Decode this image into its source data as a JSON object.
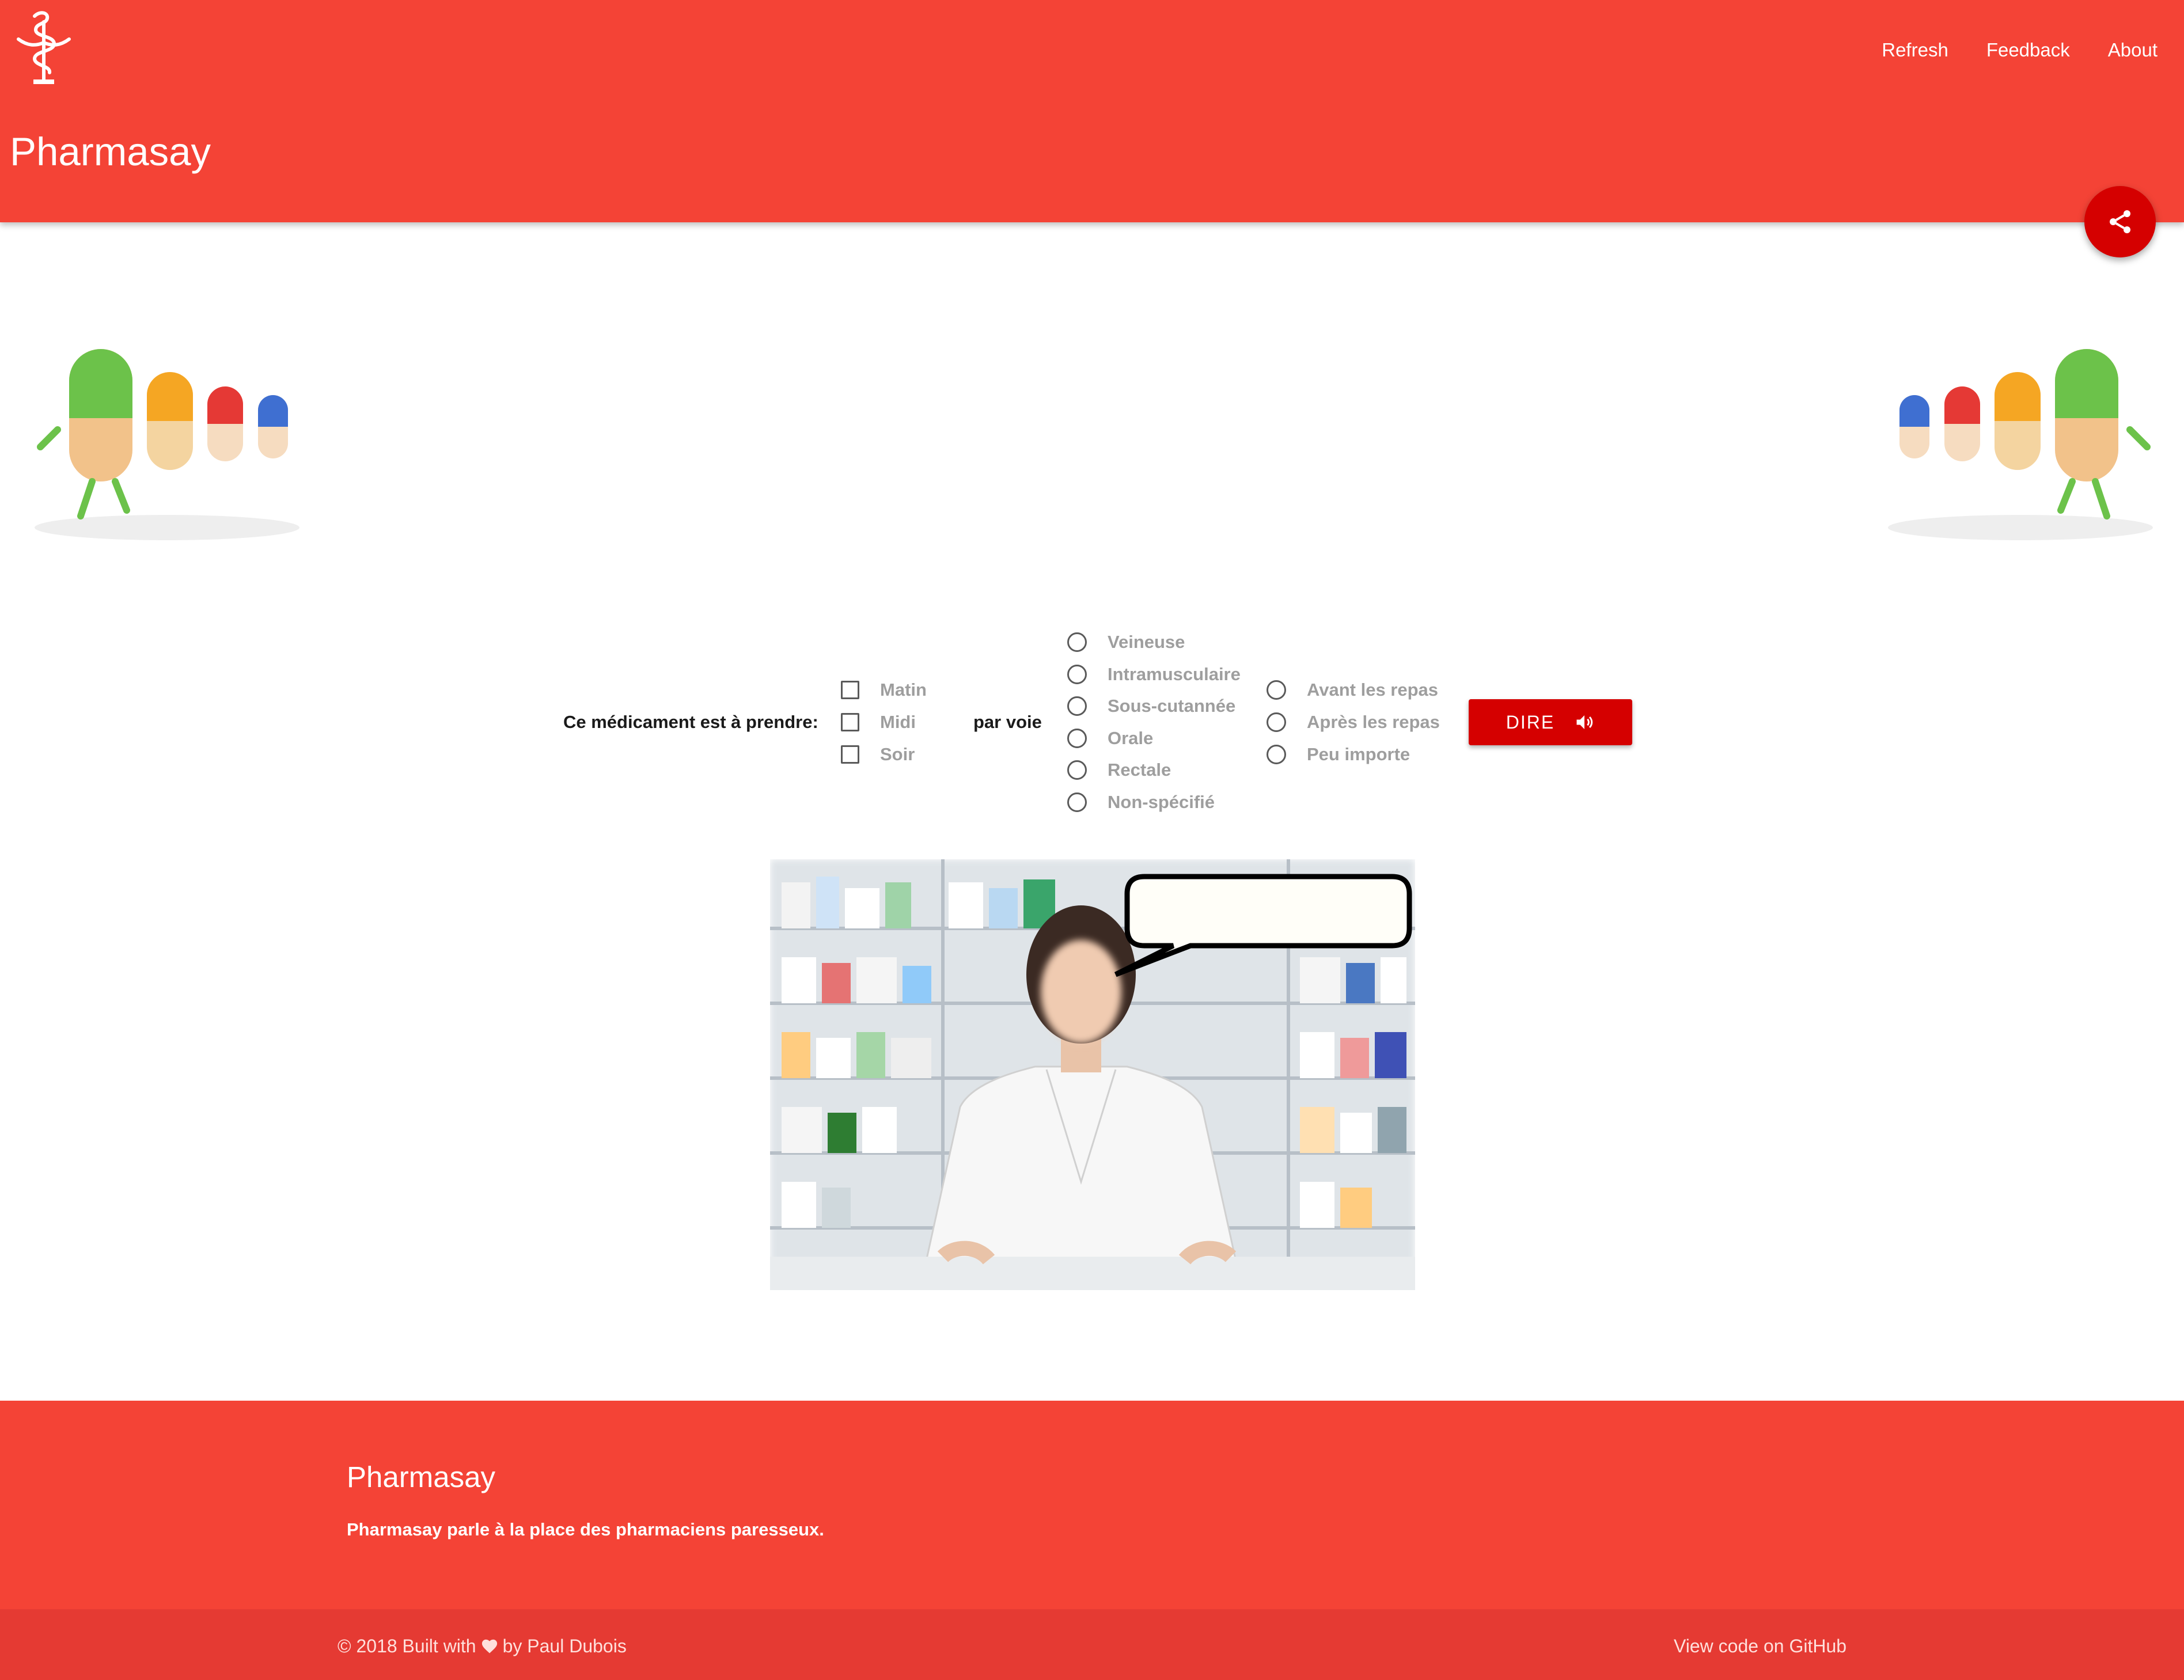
{
  "header": {
    "brand": "Pharmasay",
    "nav": {
      "refresh": "Refresh",
      "feedback": "Feedback",
      "about": "About"
    }
  },
  "form": {
    "prompt": "Ce médicament est à prendre:",
    "times": [
      "Matin",
      "Midi",
      "Soir"
    ],
    "route_label": "par voie",
    "routes": [
      "Veineuse",
      "Intramusculaire",
      "Sous-cutannée",
      "Orale",
      "Rectale",
      "Non-spécifié"
    ],
    "meal": [
      "Avant les repas",
      "Après les repas",
      "Peu importe"
    ],
    "say_button": "DIRE"
  },
  "speech_bubble": {
    "text": ""
  },
  "footer": {
    "title": "Pharmasay",
    "description": "Pharmasay parle à la place des pharmaciens paresseux.",
    "copyright_prefix": "© 2018 Built with",
    "copyright_suffix": "by Paul Dubois",
    "github_link": "View code on GitHub"
  },
  "icons": {
    "logo": "caduceus-icon",
    "share": "share-icon",
    "say": "volume-icon",
    "heart": "heart-icon"
  },
  "colors": {
    "primary": "#f44336",
    "accent": "#d50000",
    "footer_bottom": "#e53a33",
    "option_text": "#9e9e9e"
  }
}
